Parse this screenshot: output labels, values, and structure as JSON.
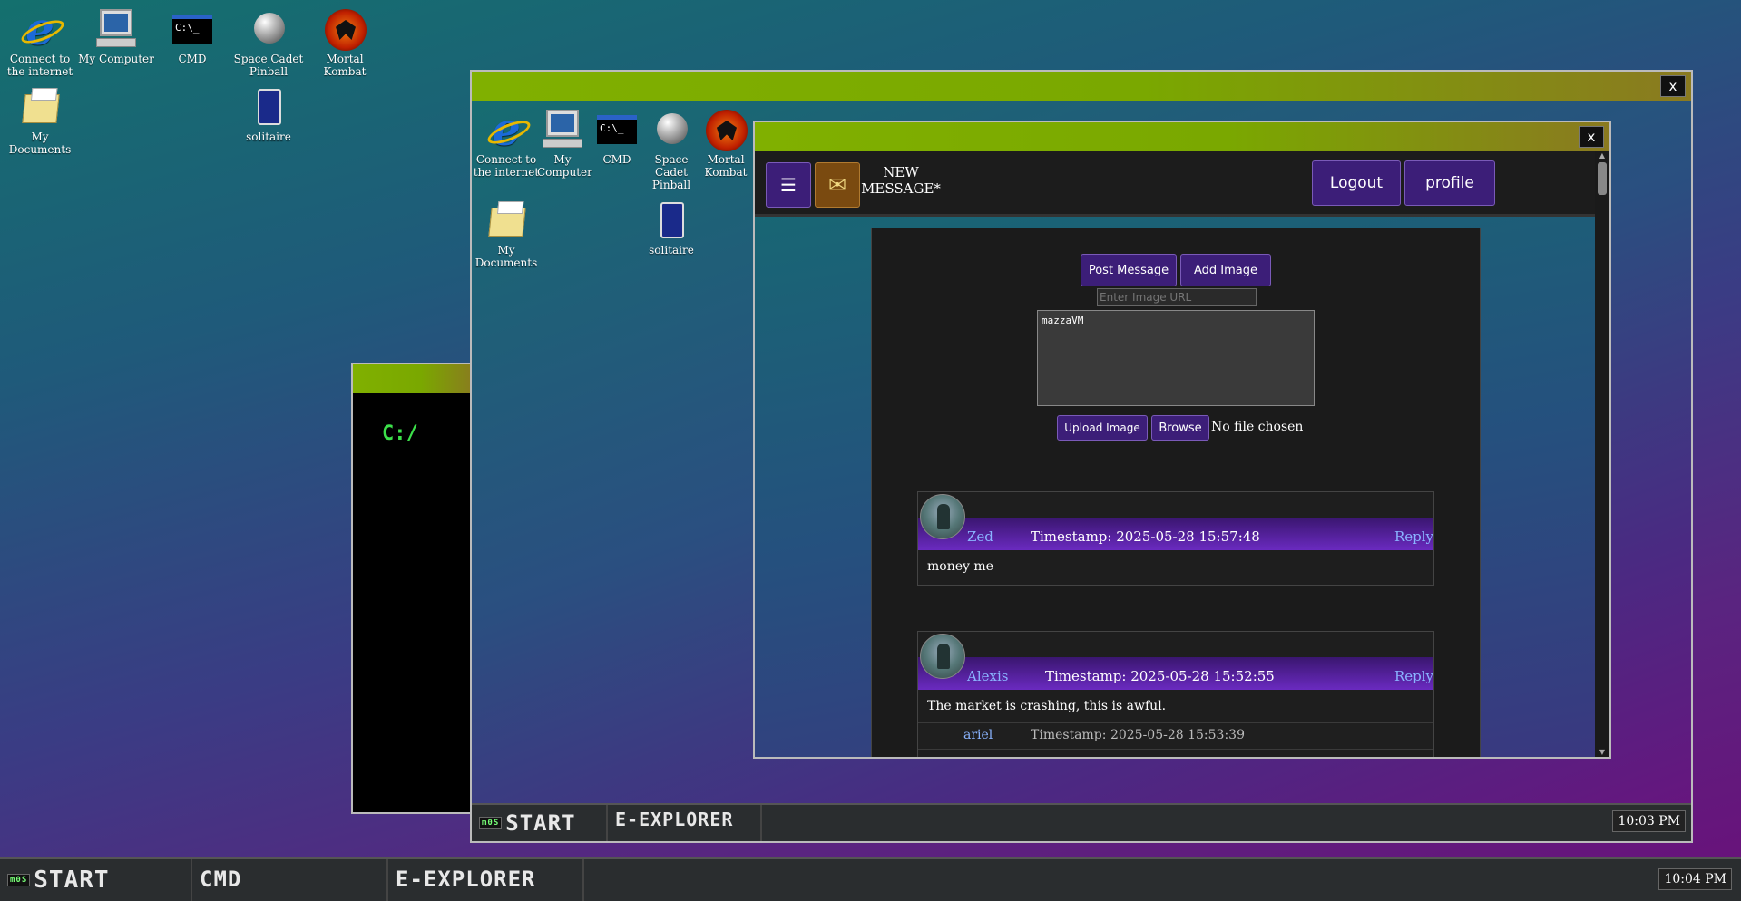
{
  "desktop": {
    "icons": [
      {
        "label": "Connect to the internet"
      },
      {
        "label": "My Computer"
      },
      {
        "label": "CMD"
      },
      {
        "label": "Space Cadet Pinball"
      },
      {
        "label": "Mortal Kombat"
      },
      {
        "label": "My Documents"
      },
      {
        "label": "solitaire"
      }
    ]
  },
  "cmd_window": {
    "prompt": "C:/"
  },
  "explorer": {
    "close_label": "x",
    "icons": [
      {
        "label": "Connect to the internet"
      },
      {
        "label": "My Computer"
      },
      {
        "label": "CMD"
      },
      {
        "label": "Space Cadet Pinball"
      },
      {
        "label": "Mortal Kombat"
      },
      {
        "label": "My Documents"
      },
      {
        "label": "solitaire"
      }
    ],
    "taskbar": {
      "start_label": "START",
      "logo": "m0S",
      "tab_label": "E-EXPLORER",
      "clock": "10:03 PM"
    }
  },
  "forum": {
    "close_label": "x",
    "menu_icon": "☰",
    "mail_icon": "✉",
    "new_message": "NEW MESSAGE*",
    "logout_label": "Logout",
    "profile_label": "profile",
    "post_message_label": "Post Message",
    "add_image_label": "Add Image",
    "image_url_placeholder": "Enter Image URL",
    "message_text": "mazzaVM",
    "upload_image_label": "Upload Image",
    "browse_label": "Browse",
    "file_status": "No file chosen",
    "posts": [
      {
        "user": "Zed",
        "timestamp": "Timestamp: 2025-05-28 15:57:48",
        "reply": "Reply",
        "text": "money me"
      },
      {
        "user": "Alexis",
        "timestamp": "Timestamp: 2025-05-28 15:52:55",
        "reply": "Reply",
        "text": "The market is crashing, this is awful.",
        "replies": [
          {
            "user": "ariel",
            "timestamp": "Timestamp: 2025-05-28 15:53:39"
          }
        ]
      }
    ]
  },
  "taskbar": {
    "logo": "m0S",
    "start_label": "START",
    "items": [
      "CMD",
      "E-EXPLORER"
    ],
    "clock": "10:04 PM"
  }
}
